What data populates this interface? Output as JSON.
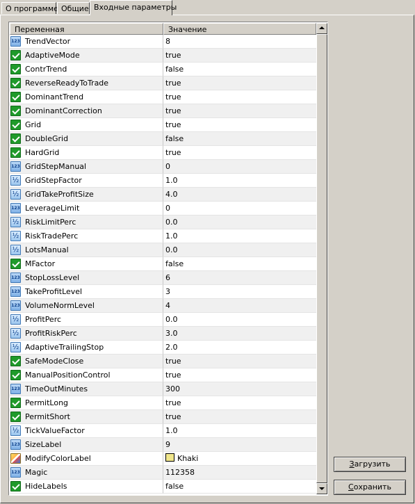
{
  "tabs": [
    {
      "label": "О программе",
      "active": false
    },
    {
      "label": "Общие",
      "active": false
    },
    {
      "label": "Входные параметры",
      "active": true
    }
  ],
  "grid": {
    "columns": [
      "Переменная",
      "Значение"
    ],
    "rows": [
      {
        "name": "TrendVector",
        "value": "8",
        "type": "int",
        "icon": "integer-icon"
      },
      {
        "name": "AdaptiveMode",
        "value": "true",
        "type": "bool",
        "icon": "boolean-icon"
      },
      {
        "name": "ContrTrend",
        "value": "false",
        "type": "bool",
        "icon": "boolean-icon"
      },
      {
        "name": "ReverseReadyToTrade",
        "value": "true",
        "type": "bool",
        "icon": "boolean-icon"
      },
      {
        "name": "DominantTrend",
        "value": "true",
        "type": "bool",
        "icon": "boolean-icon"
      },
      {
        "name": "DominantCorrection",
        "value": "true",
        "type": "bool",
        "icon": "boolean-icon"
      },
      {
        "name": "Grid",
        "value": "true",
        "type": "bool",
        "icon": "boolean-icon"
      },
      {
        "name": "DoubleGrid",
        "value": "false",
        "type": "bool",
        "icon": "boolean-icon"
      },
      {
        "name": "HardGrid",
        "value": "true",
        "type": "bool",
        "icon": "boolean-icon"
      },
      {
        "name": "GridStepManual",
        "value": "0",
        "type": "int",
        "icon": "integer-icon"
      },
      {
        "name": "GridStepFactor",
        "value": "1.0",
        "type": "double",
        "icon": "double-icon"
      },
      {
        "name": "GridTakeProfitSize",
        "value": "4.0",
        "type": "double",
        "icon": "double-icon"
      },
      {
        "name": "LeverageLimit",
        "value": "0",
        "type": "int",
        "icon": "integer-icon"
      },
      {
        "name": "RiskLimitPerc",
        "value": "0.0",
        "type": "double",
        "icon": "double-icon"
      },
      {
        "name": "RiskTradePerc",
        "value": "1.0",
        "type": "double",
        "icon": "double-icon"
      },
      {
        "name": "LotsManual",
        "value": "0.0",
        "type": "double",
        "icon": "double-icon"
      },
      {
        "name": "MFactor",
        "value": "false",
        "type": "bool",
        "icon": "boolean-icon"
      },
      {
        "name": "StopLossLevel",
        "value": "6",
        "type": "int",
        "icon": "integer-icon"
      },
      {
        "name": "TakeProfitLevel",
        "value": "3",
        "type": "int",
        "icon": "integer-icon"
      },
      {
        "name": "VolumeNormLevel",
        "value": "4",
        "type": "int",
        "icon": "integer-icon"
      },
      {
        "name": "ProfitPerc",
        "value": "0.0",
        "type": "double",
        "icon": "double-icon"
      },
      {
        "name": "ProfitRiskPerc",
        "value": "3.0",
        "type": "double",
        "icon": "double-icon"
      },
      {
        "name": "AdaptiveTrailingStop",
        "value": "2.0",
        "type": "double",
        "icon": "double-icon"
      },
      {
        "name": "SafeModeClose",
        "value": "true",
        "type": "bool",
        "icon": "boolean-icon"
      },
      {
        "name": "ManualPositionControl",
        "value": "true",
        "type": "bool",
        "icon": "boolean-icon"
      },
      {
        "name": "TimeOutMinutes",
        "value": "300",
        "type": "int",
        "icon": "integer-icon"
      },
      {
        "name": "PermitLong",
        "value": "true",
        "type": "bool",
        "icon": "boolean-icon"
      },
      {
        "name": "PermitShort",
        "value": "true",
        "type": "bool",
        "icon": "boolean-icon"
      },
      {
        "name": "TickValueFactor",
        "value": "1.0",
        "type": "double",
        "icon": "double-icon"
      },
      {
        "name": "SizeLabel",
        "value": "9",
        "type": "int",
        "icon": "integer-icon"
      },
      {
        "name": "ModifyColorLabel",
        "value": "Khaki",
        "type": "color",
        "icon": "color-icon",
        "swatch": "#f0e68c"
      },
      {
        "name": "Magic",
        "value": "112358",
        "type": "int",
        "icon": "integer-icon"
      },
      {
        "name": "HideLabels",
        "value": "false",
        "type": "bool",
        "icon": "boolean-icon"
      }
    ]
  },
  "buttons": {
    "load": {
      "accel": "З",
      "rest": "агрузить"
    },
    "save": {
      "accel": "С",
      "rest": "охранить"
    }
  }
}
